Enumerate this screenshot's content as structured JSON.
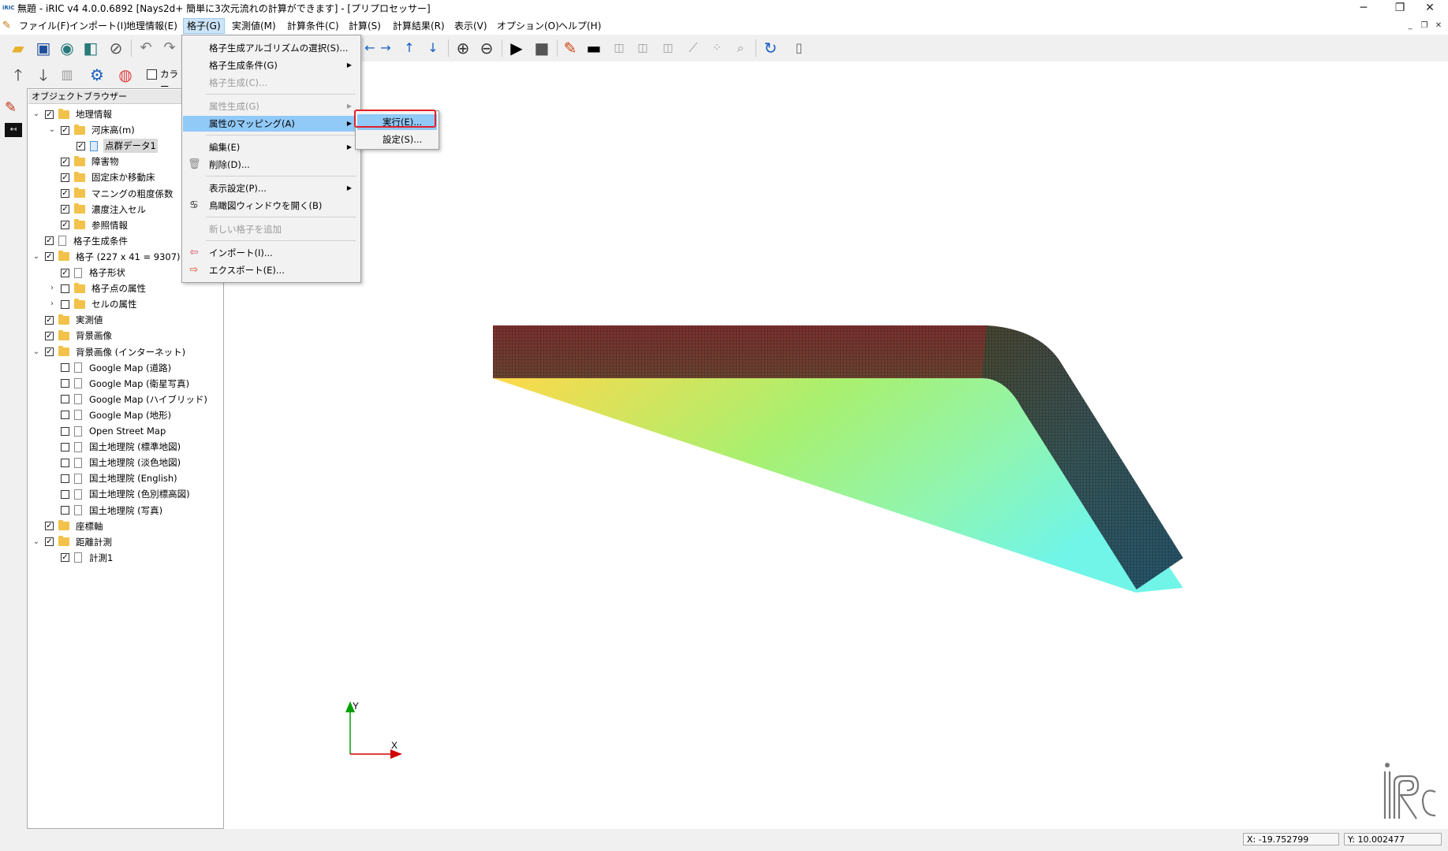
{
  "window": {
    "title": "無題 - iRIC v4 4.0.0.6892 [Nays2d+ 簡単に3次元流れの計算ができます] - [プリプロセッサー]",
    "app_icon": "iRIC",
    "minimize_glyph": "─",
    "restore_glyph": "❐",
    "close_glyph": "✕"
  },
  "menubar": {
    "items": [
      "ファイル(F)",
      "インポート(I)",
      "地理情報(E)",
      "格子(G)",
      "実測値(M)",
      "計算条件(C)",
      "計算(S)",
      "計算結果(R)",
      "表示(V)",
      "オプション(O)",
      "ヘルプ(H)"
    ],
    "mdi_buttons": [
      "_",
      "❐",
      "✕"
    ]
  },
  "toolbar": {
    "color_checkbox_label": "カラー"
  },
  "object_browser": {
    "title": "オブジェクトブラウザー",
    "items": [
      {
        "label": "地理情報",
        "expander": "open",
        "checked": true,
        "icon": "folder"
      },
      {
        "label": "河床高(m)",
        "expander": "open",
        "checked": true,
        "icon": "folder"
      },
      {
        "label": "点群データ1",
        "expander": "none",
        "checked": true,
        "icon": "doc-blue"
      },
      {
        "label": "障害物",
        "expander": "none",
        "checked": true,
        "icon": "folder"
      },
      {
        "label": "固定床か移動床",
        "expander": "none",
        "checked": true,
        "icon": "folder"
      },
      {
        "label": "マニングの粗度係数",
        "expander": "none",
        "checked": true,
        "icon": "folder"
      },
      {
        "label": "濃度注入セル",
        "expander": "none",
        "checked": true,
        "icon": "folder"
      },
      {
        "label": "参照情報",
        "expander": "none",
        "checked": true,
        "icon": "folder"
      },
      {
        "label": "格子生成条件",
        "expander": "none",
        "checked": true,
        "icon": "doc"
      },
      {
        "label": "格子 (227 x 41 = 9307)",
        "expander": "open",
        "checked": true,
        "icon": "folder"
      },
      {
        "label": "格子形状",
        "expander": "none",
        "checked": true,
        "icon": "doc"
      },
      {
        "label": "格子点の属性",
        "expander": "closed",
        "checked": false,
        "icon": "folder"
      },
      {
        "label": "セルの属性",
        "expander": "closed",
        "checked": false,
        "icon": "folder"
      },
      {
        "label": "実測値",
        "expander": "none",
        "checked": true,
        "icon": "folder"
      },
      {
        "label": "背景画像",
        "expander": "none",
        "checked": true,
        "icon": "folder"
      },
      {
        "label": "背景画像 (インターネット)",
        "expander": "open",
        "checked": true,
        "icon": "folder"
      },
      {
        "label": "Google Map (道路)",
        "expander": "none",
        "checked": false,
        "icon": "doc"
      },
      {
        "label": "Google Map (衛星写真)",
        "expander": "none",
        "checked": false,
        "icon": "doc"
      },
      {
        "label": "Google Map (ハイブリッド)",
        "expander": "none",
        "checked": false,
        "icon": "doc"
      },
      {
        "label": "Google Map (地形)",
        "expander": "none",
        "checked": false,
        "icon": "doc"
      },
      {
        "label": "Open Street Map",
        "expander": "none",
        "checked": false,
        "icon": "doc"
      },
      {
        "label": "国土地理院 (標準地図)",
        "expander": "none",
        "checked": false,
        "icon": "doc"
      },
      {
        "label": "国土地理院 (淡色地図)",
        "expander": "none",
        "checked": false,
        "icon": "doc"
      },
      {
        "label": "国土地理院 (English)",
        "expander": "none",
        "checked": false,
        "icon": "doc"
      },
      {
        "label": "国土地理院 (色別標高図)",
        "expander": "none",
        "checked": false,
        "icon": "doc"
      },
      {
        "label": "国土地理院 (写真)",
        "expander": "none",
        "checked": false,
        "icon": "doc"
      },
      {
        "label": "座標軸",
        "expander": "none",
        "checked": true,
        "icon": "folder"
      },
      {
        "label": "距離計測",
        "expander": "open",
        "checked": true,
        "icon": "folder"
      },
      {
        "label": "計測1",
        "expander": "none",
        "checked": true,
        "icon": "doc"
      }
    ]
  },
  "grid_menu": {
    "items": [
      {
        "label": "格子生成アルゴリズムの選択(S)...",
        "disabled": false,
        "submenu": false,
        "icon": ""
      },
      {
        "label": "格子生成条件(G)",
        "disabled": false,
        "submenu": true,
        "icon": ""
      },
      {
        "label": "格子生成(C)...",
        "disabled": true,
        "submenu": false,
        "icon": ""
      },
      {
        "label": "属性生成(G)",
        "disabled": true,
        "submenu": true,
        "icon": ""
      },
      {
        "label": "属性のマッピング(A)",
        "disabled": false,
        "submenu": true,
        "icon": "",
        "hover": true
      },
      {
        "label": "編集(E)",
        "disabled": false,
        "submenu": true,
        "icon": ""
      },
      {
        "label": "削除(D)...",
        "disabled": false,
        "submenu": false,
        "icon": "trash"
      },
      {
        "label": "表示設定(P)...",
        "disabled": false,
        "submenu": true,
        "icon": ""
      },
      {
        "label": "鳥瞰図ウィンドウを開く(B)",
        "disabled": false,
        "submenu": false,
        "icon": "birdeye"
      },
      {
        "label": "新しい格子を追加",
        "disabled": true,
        "submenu": false,
        "icon": ""
      },
      {
        "label": "インポート(I)...",
        "disabled": false,
        "submenu": false,
        "icon": "import"
      },
      {
        "label": "エクスポート(E)...",
        "disabled": false,
        "submenu": false,
        "icon": "export"
      }
    ]
  },
  "mapping_submenu": {
    "items": [
      "実行(E)...",
      "設定(S)..."
    ]
  },
  "axes": {
    "x_label": "X",
    "y_label": "Y"
  },
  "status": {
    "x_coord": "X: -19.752799",
    "y_coord": "Y: 10.002477"
  },
  "colors": {
    "menu_hover": "#91c9f7",
    "highlight": "#e0202a",
    "axis_x": "#d00000",
    "axis_y": "#00a000"
  }
}
